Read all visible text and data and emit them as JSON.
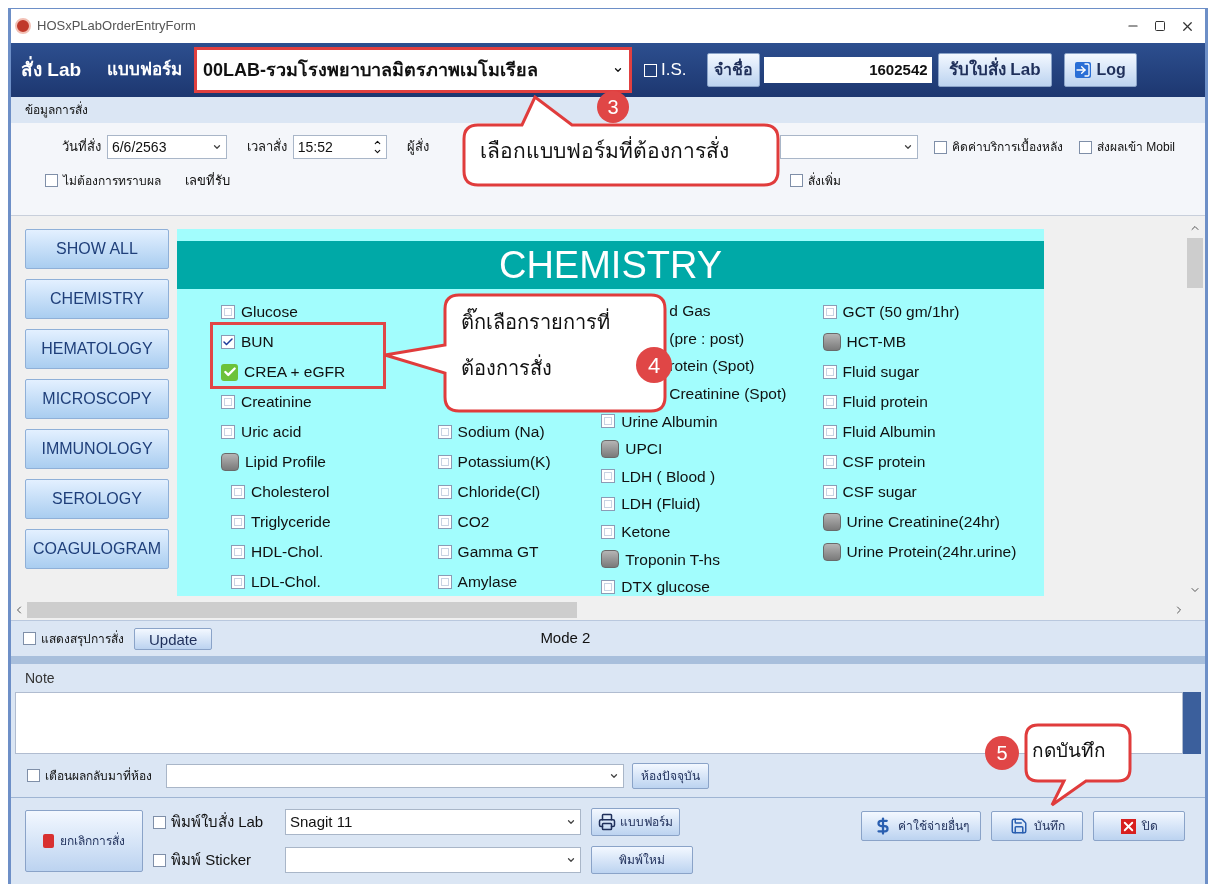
{
  "window": {
    "title": "HOSxPLabOrderEntryForm"
  },
  "header": {
    "title": "สั่ง Lab",
    "form_label": "แบบฟอร์ม",
    "form_value": "00LAB-รวมโรงพยาบาลมิตรภาพเมโมเรียล",
    "is": {
      "label": "I.S.",
      "checked": false
    },
    "remember_button": "จำชื่อ",
    "hn_value": "1602542",
    "receive_button": "รับใบสั่ง Lab",
    "log_button": "Log"
  },
  "order_info": {
    "section_title": "ข้อมูลการสั่ง",
    "date_label": "วันที่สั่ง",
    "date_value": "6/6/2563",
    "time_label": "เวลาสั่ง",
    "time_value": "15:52",
    "orderer_label": "ผู้สั่ง",
    "options": [
      {
        "label": "คิดค่าบริการเบื้องหลัง",
        "checked": false
      },
      {
        "label": "ส่งผลเข้า Mobil",
        "checked": false
      }
    ],
    "no_result": {
      "label": "ไม่ต้องการทราบผล",
      "checked": false
    },
    "receive_no_label": "เลขที่รับ",
    "add_more": {
      "label": "สั่งเพิ่ม",
      "checked": false
    }
  },
  "categories": [
    "SHOW ALL",
    "CHEMISTRY",
    "HEMATOLOGY",
    "MICROSCOPY",
    "IMMUNOLOGY",
    "SEROLOGY",
    "COAGULOGRAM"
  ],
  "panel": {
    "title": "CHEMISTRY",
    "columns": [
      [
        {
          "kind": "checkbox",
          "label": "Glucose",
          "checked": false
        },
        {
          "kind": "checkbox",
          "label": "BUN",
          "checked": true
        },
        {
          "kind": "tick",
          "label": "CREA + eGFR",
          "checked": true
        },
        {
          "kind": "checkbox",
          "label": "Creatinine",
          "checked": false
        },
        {
          "kind": "checkbox",
          "label": "Uric acid",
          "checked": false
        },
        {
          "kind": "group",
          "label": "Lipid Profile",
          "children": [
            {
              "kind": "checkbox",
              "label": "Cholesterol",
              "checked": false
            },
            {
              "kind": "checkbox",
              "label": "Triglyceride",
              "checked": false
            },
            {
              "kind": "checkbox",
              "label": "HDL-Chol.",
              "checked": false
            },
            {
              "kind": "checkbox",
              "label": "LDL-Chol.",
              "checked": false
            }
          ]
        }
      ],
      [
        {
          "kind": "checkbox",
          "label": "Sodium (Na)",
          "checked": false
        },
        {
          "kind": "checkbox",
          "label": "Potassium(K)",
          "checked": false
        },
        {
          "kind": "checkbox",
          "label": "Chloride(Cl)",
          "checked": false
        },
        {
          "kind": "checkbox",
          "label": "CO2",
          "checked": false
        },
        {
          "kind": "checkbox",
          "label": "Gamma GT",
          "checked": false
        },
        {
          "kind": "checkbox",
          "label": "Amylase",
          "checked": false
        }
      ],
      [
        {
          "kind": "partial",
          "label": "d Gas"
        },
        {
          "kind": "partial",
          "label": "(pre : post)"
        },
        {
          "kind": "partial",
          "label": "rotein (Spot)"
        },
        {
          "kind": "partial",
          "label": "Creatinine (Spot)"
        },
        {
          "kind": "checkbox",
          "label": "Urine Albumin",
          "checked": false
        },
        {
          "kind": "group",
          "label": "UPCI"
        },
        {
          "kind": "checkbox",
          "label": "LDH ( Blood )",
          "checked": false
        },
        {
          "kind": "checkbox",
          "label": "LDH (Fluid)",
          "checked": false
        },
        {
          "kind": "checkbox",
          "label": "Ketone",
          "checked": false
        },
        {
          "kind": "group",
          "label": "Troponin T-hs"
        },
        {
          "kind": "checkbox",
          "label": "DTX glucose",
          "checked": false
        }
      ],
      [
        {
          "kind": "checkbox",
          "label": "GCT (50 gm/1hr)",
          "checked": false
        },
        {
          "kind": "group",
          "label": "HCT-MB"
        },
        {
          "kind": "checkbox",
          "label": "Fluid sugar",
          "checked": false
        },
        {
          "kind": "checkbox",
          "label": "Fluid protein",
          "checked": false
        },
        {
          "kind": "checkbox",
          "label": "Fluid Albumin",
          "checked": false
        },
        {
          "kind": "checkbox",
          "label": "CSF protein",
          "checked": false
        },
        {
          "kind": "checkbox",
          "label": "CSF sugar",
          "checked": false
        },
        {
          "kind": "group",
          "label": "Urine Creatinine(24hr)"
        },
        {
          "kind": "group",
          "label": "Urine Protein(24hr.urine)"
        }
      ]
    ]
  },
  "summary_bar": {
    "show_summary": {
      "label": "แสดงสรุปการสั่ง",
      "checked": false
    },
    "update_button": "Update",
    "mode": "Mode 2"
  },
  "note": {
    "label": "Note"
  },
  "notify": {
    "label": "เตือนผลกลับมาที่ห้อง",
    "checked": false,
    "room_button": "ห้องปัจจุบัน"
  },
  "footer": {
    "cancel_button": "ยกเลิกการสั่ง",
    "print_lab": {
      "label": "พิมพ์ใบสั่ง Lab",
      "checked": false
    },
    "printer_value": "Snagit 11",
    "print_sticker": {
      "label": "พิมพ์ Sticker",
      "checked": false
    },
    "form_button": "แบบฟอร์ม",
    "reprint_button": "พิมพ์ใหม่",
    "expense_button": "ค่าใช้จ่ายอื่นๆ",
    "save_button": "บันทึก",
    "close_button": "ปิด"
  },
  "callouts": [
    {
      "number": "3",
      "lines": [
        "เลือกแบบฟอร์มที่ต้องการสั่ง"
      ]
    },
    {
      "number": "4",
      "lines": [
        "ติ๊กเลือกรายการที่",
        "ต้องการสั่ง"
      ]
    },
    {
      "number": "5",
      "lines": [
        "กดบันทึก"
      ]
    }
  ]
}
